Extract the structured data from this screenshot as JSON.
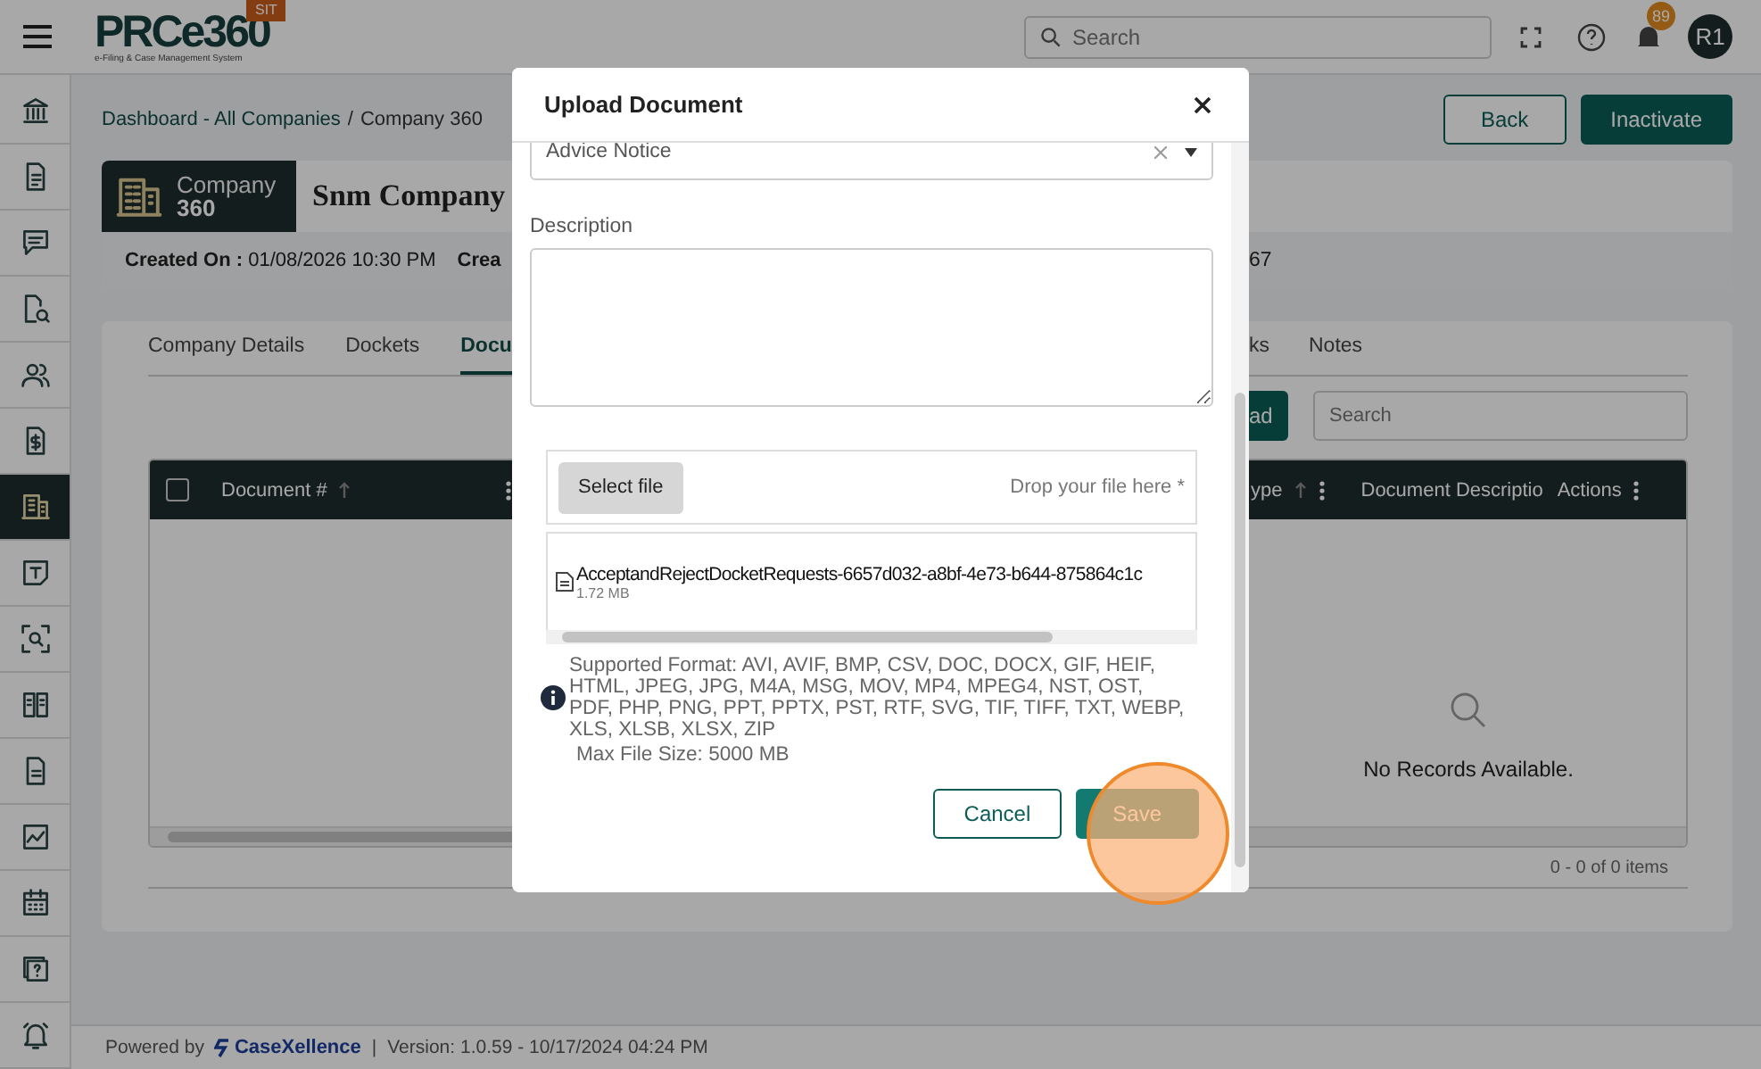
{
  "topbar": {
    "logo": "PRCe360",
    "logo_tagline": "e-Filing & Case Management System",
    "env_badge": "SIT",
    "search": {
      "placeholder": "Search"
    },
    "notification_count": "89",
    "avatar": "R1"
  },
  "sidebar": {
    "items": [
      {
        "selected": false
      },
      {
        "selected": false
      },
      {
        "selected": false
      },
      {
        "selected": false
      },
      {
        "selected": false
      },
      {
        "selected": false
      },
      {
        "selected": true
      },
      {
        "selected": false
      },
      {
        "selected": false
      },
      {
        "selected": false
      },
      {
        "selected": false
      },
      {
        "selected": false
      },
      {
        "selected": false
      },
      {
        "selected": false
      },
      {
        "selected": false
      }
    ]
  },
  "breadcrumb": {
    "link": "Dashboard - All Companies",
    "separator": "/",
    "current": "Company 360"
  },
  "header_buttons": [
    {
      "label": "Back",
      "kind": "outline"
    },
    {
      "label": "Inactivate",
      "kind": "primary"
    }
  ],
  "company": {
    "badge_title": "Company",
    "badge_number": "360",
    "name": "Snm Company",
    "created_label": "Created On :",
    "created_value": "01/08/2026 10:30 PM",
    "second_label": "Crea",
    "right_value": "67"
  },
  "tabs": {
    "left": [
      {
        "label": "Company Details",
        "selected": false
      },
      {
        "label": "Dockets",
        "selected": false
      },
      {
        "label": "Docu",
        "selected": true
      }
    ],
    "right": [
      {
        "label": "ks",
        "selected": false
      },
      {
        "label": "Notes",
        "selected": false
      }
    ]
  },
  "toolbar": {
    "upload_button": "ad",
    "search": {
      "placeholder": "Search"
    }
  },
  "table": {
    "select_all": {
      "checked": false
    },
    "left_columns": [
      {
        "label": "Document #",
        "sortable": true,
        "menu": true
      }
    ],
    "right_columns": [
      {
        "label": "ype",
        "sortable": true,
        "menu": true
      },
      {
        "label": "Document Descriptio",
        "sortable": false,
        "menu": false
      },
      {
        "label": "Actions",
        "sortable": false,
        "menu": true
      }
    ],
    "empty_message": "No Records Available.",
    "pager": "0 - 0 of 0 items"
  },
  "modal": {
    "title": "Upload Document",
    "document_type": {
      "value": "Advice Notice"
    },
    "description": {
      "label": "Description"
    },
    "upload": {
      "button": "Select file",
      "hint": "Drop your file here *"
    },
    "files": [
      {
        "name": "AcceptandRejectDocketRequests-6657d032-a8bf-4e73-b644-875864c1c",
        "size": "1.72 MB"
      }
    ],
    "supported_formats": "Supported Format: AVI, AVIF, BMP, CSV, DOC, DOCX, GIF, HEIF, HTML, JPEG, JPG, M4A, MSG, MOV, MP4, MPEG4, NST, OST, PDF, PHP, PNG, PPT, PPTX, PST, RTF, SVG, TIF, TIFF, TXT, WEBP, XLS, XLSB, XLSX, ZIP",
    "max_size": "Max File Size: 5000 MB",
    "buttons": [
      {
        "label": "Cancel",
        "kind": "secondary"
      },
      {
        "label": "Save",
        "kind": "primary"
      }
    ]
  },
  "footer": {
    "powered_by": "Powered by",
    "brand": "CaseXellence",
    "separator": "|",
    "version": "Version: 1.0.59 - 10/17/2024 04:24 PM"
  }
}
